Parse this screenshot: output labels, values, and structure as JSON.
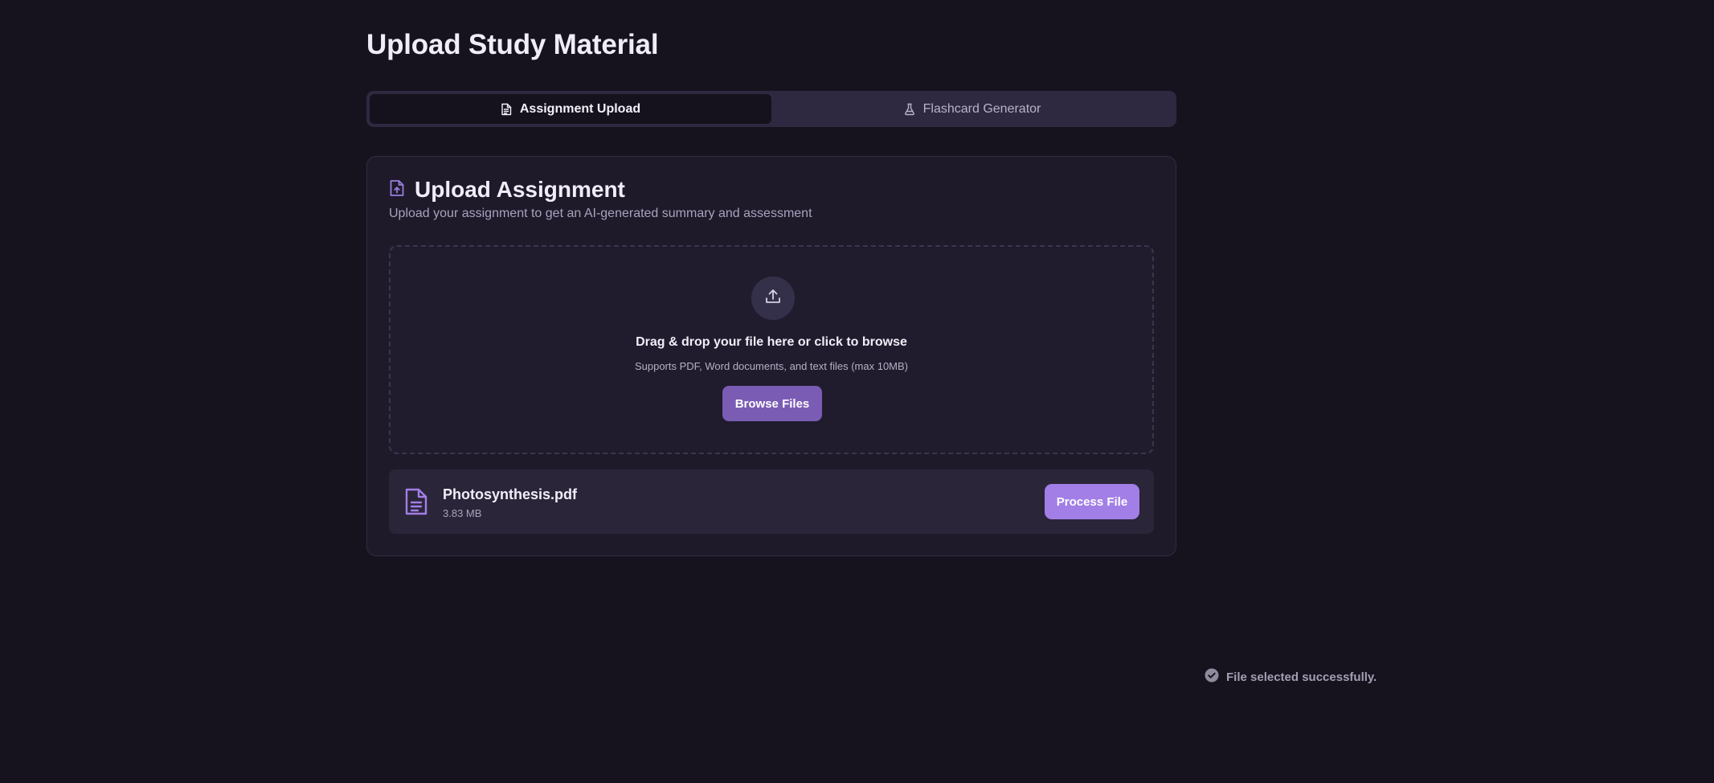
{
  "page": {
    "title": "Upload Study Material"
  },
  "tabs": [
    {
      "label": "Assignment Upload",
      "icon": "file-text-icon",
      "active": true
    },
    {
      "label": "Flashcard Generator",
      "icon": "flask-icon",
      "active": false
    }
  ],
  "card": {
    "icon": "file-upload-icon",
    "title": "Upload Assignment",
    "description": "Upload your assignment to get an AI-generated summary and assessment"
  },
  "dropzone": {
    "icon": "upload-icon",
    "main_text": "Drag & drop your file here or click to browse",
    "sub_text": "Supports PDF, Word documents, and text files (max 10MB)",
    "browse_label": "Browse Files"
  },
  "selected_file": {
    "icon": "document-icon",
    "name": "Photosynthesis.pdf",
    "size": "3.83 MB",
    "process_label": "Process File"
  },
  "toast": {
    "icon": "check-circle-icon",
    "message": "File selected successfully."
  },
  "colors": {
    "background": "#16131f",
    "card": "#1e1a2a",
    "accent": "#a27fe6",
    "accent_dark": "#7a5cb5",
    "icon_purple": "#9b7fe0"
  }
}
